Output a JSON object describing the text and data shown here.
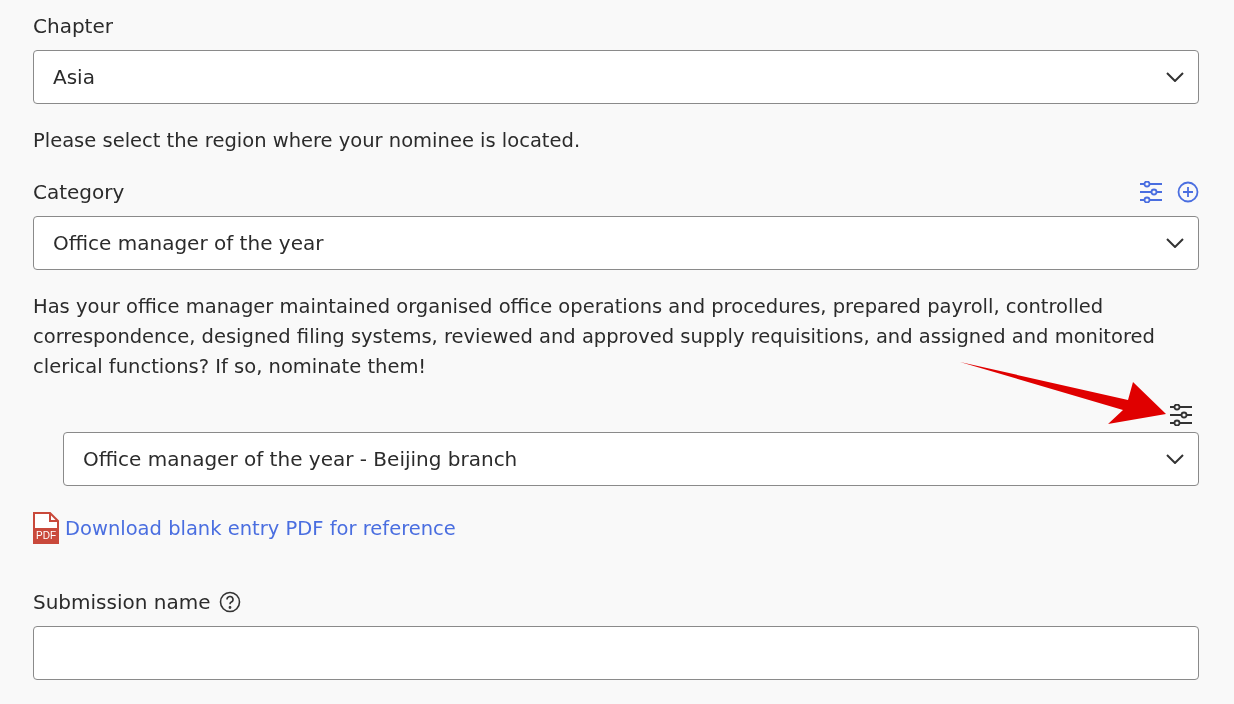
{
  "chapter": {
    "label": "Chapter",
    "value": "Asia",
    "help": "Please select the region where your nominee is located."
  },
  "category": {
    "label": "Category",
    "value": "Office manager of the year",
    "description": "Has your office manager maintained organised office operations and procedures, prepared payroll, controlled correspondence, designed filing systems, reviewed and approved supply requisitions, and assigned and monitored clerical functions? If so, nominate them!"
  },
  "subcategory": {
    "value": "Office manager of the year - Beijing branch"
  },
  "download": {
    "icon_label": "PDF",
    "link": "Download blank entry PDF for reference"
  },
  "submission": {
    "label": "Submission name"
  }
}
